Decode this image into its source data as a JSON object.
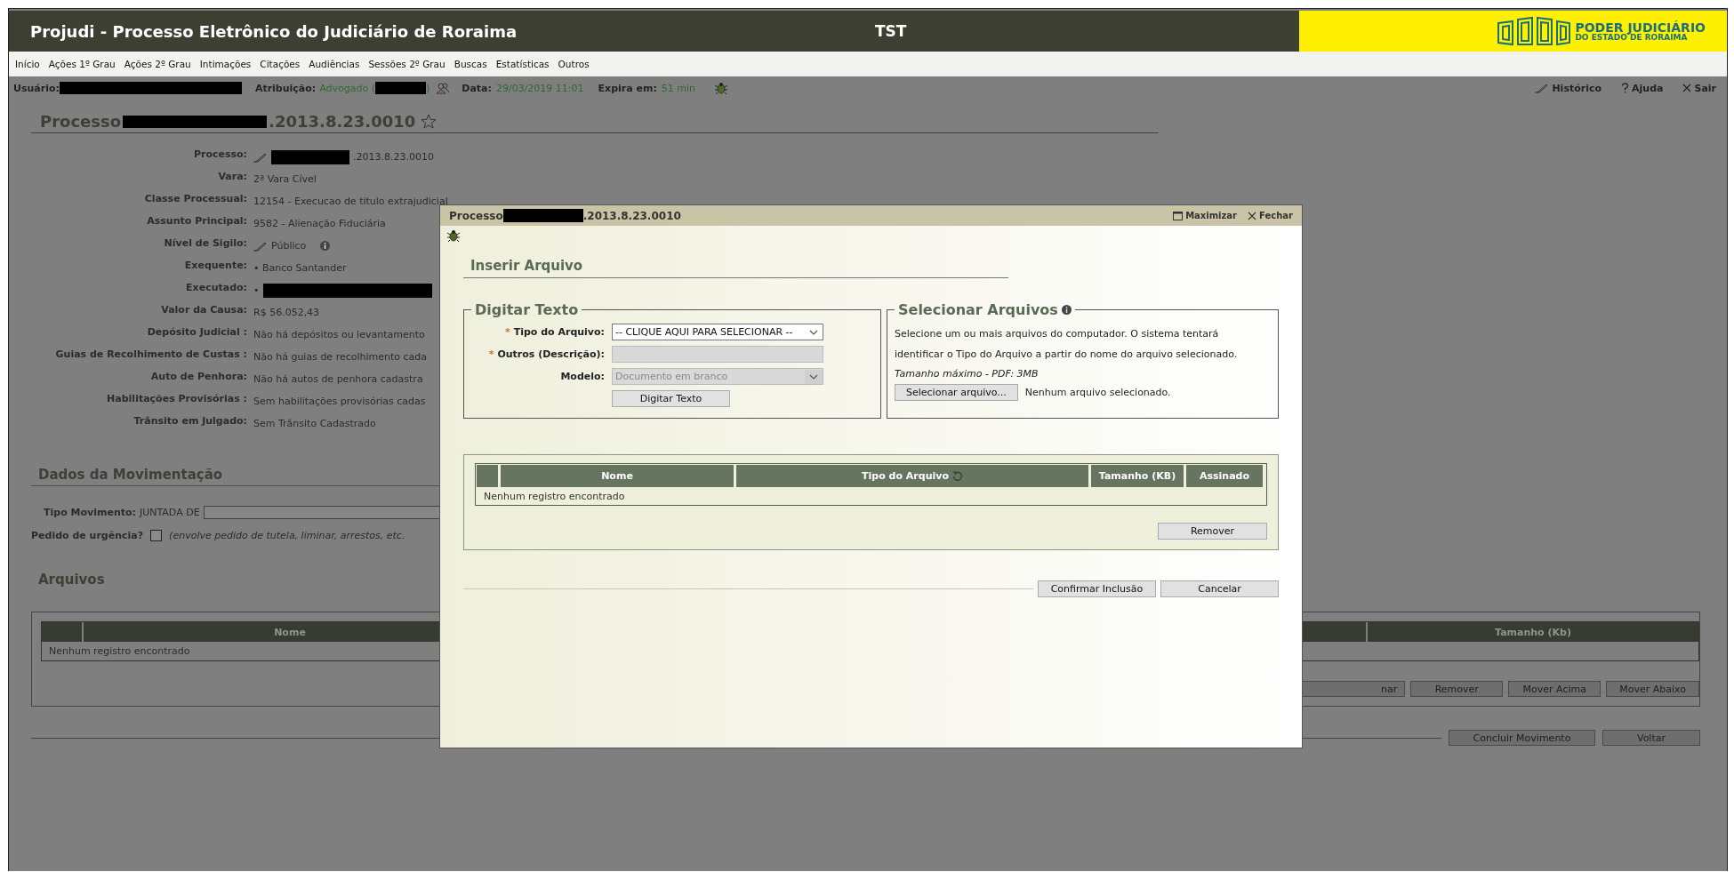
{
  "header": {
    "title": "Projudi - Processo Eletrônico do Judiciário de Roraima",
    "center_label": "TST",
    "logo": {
      "line_1": "PODER JUDICIÁRIO",
      "line_2": "DO ESTADO DE RORAIMA"
    }
  },
  "menu": [
    "Início",
    "Ações 1º Grau",
    "Ações 2º Grau",
    "Intimações",
    "Citações",
    "Audiências",
    "Sessões 2º Grau",
    "Buscas",
    "Estatísticas",
    "Outros"
  ],
  "user_bar": {
    "user_label": "Usuário:",
    "attribution_label": "Atribuição:",
    "attribution_prefix": "Advogado (",
    "attribution_suffix": ")",
    "date_label": "Data:",
    "date_value": "29/03/2019 11:01",
    "expires_label": "Expira em:",
    "expires_value": "51 min",
    "links": [
      {
        "kind": "history",
        "label": "Histórico"
      },
      {
        "kind": "help",
        "label": "Ajuda"
      },
      {
        "kind": "exit",
        "label": "Sair"
      }
    ]
  },
  "process": {
    "title_parts": [
      {
        "kind": "text",
        "text": "Processo"
      },
      {
        "kind": "redacted"
      },
      {
        "kind": "text",
        "text": ".2013.8.23.0010"
      }
    ],
    "favorite": false,
    "details": [
      {
        "label": "Processo:",
        "parts": [
          {
            "kind": "edit"
          },
          {
            "kind": "redacted"
          },
          {
            "kind": "text",
            "text": ".2013.8.23.0010"
          }
        ]
      },
      {
        "label": "Vara:",
        "parts": [
          {
            "kind": "text",
            "text": "2ª Vara Cível"
          }
        ]
      },
      {
        "label": "Classe Processual:",
        "parts": [
          {
            "kind": "text",
            "text": "12154 - Execucao de titulo extrajudicial"
          }
        ]
      },
      {
        "label": "Assunto Principal:",
        "parts": [
          {
            "kind": "text",
            "text": "9582 - Alienação Fiduciária"
          }
        ]
      },
      {
        "label": "Nível de Sigilo:",
        "parts": [
          {
            "kind": "edit"
          },
          {
            "kind": "text",
            "text": "Público"
          },
          {
            "kind": "info"
          }
        ]
      },
      {
        "label": "Exequente:",
        "parts": [
          {
            "kind": "text",
            "text": "• Banco Santander"
          }
        ]
      },
      {
        "label": "Executado:",
        "parts": [
          {
            "kind": "text",
            "text": "•"
          },
          {
            "kind": "redacted-wide"
          }
        ]
      },
      {
        "label": "Valor da Causa:",
        "parts": [
          {
            "kind": "text",
            "text": "R$ 56.052,43"
          }
        ]
      },
      {
        "label": "Depósito Judicial :",
        "parts": [
          {
            "kind": "text",
            "text": "Não há depósitos ou levantamento"
          }
        ]
      },
      {
        "label": "Guias de Recolhimento de Custas :",
        "parts": [
          {
            "kind": "text",
            "text": "Não há guias de recolhimento cada"
          }
        ]
      },
      {
        "label": "Auto de Penhora:",
        "parts": [
          {
            "kind": "text",
            "text": "Não há autos de penhora cadastra"
          }
        ]
      },
      {
        "label": "Habilitações Provisórias :",
        "parts": [
          {
            "kind": "text",
            "text": "Sem habilitações provisórias cadas"
          }
        ]
      },
      {
        "label": "Trânsito em Julgado:",
        "parts": [
          {
            "kind": "text",
            "text": "Sem Trânsito Cadastrado"
          }
        ]
      }
    ]
  },
  "movement": {
    "heading": "Dados da Movimentação",
    "type_label": "Tipo Movimento:",
    "type_value": "JUNTADA DE",
    "urgency_label": "Pedido de urgência?",
    "urgency_checked": false,
    "urgency_note": "(envolve pedido de tutela, liminar, arrestos, etc."
  },
  "files": {
    "heading": "Arquivos",
    "columns": [
      "Nome",
      "Tamanho (Kb)"
    ],
    "empty_message": "Nenhum registro encontrado",
    "buttons": [
      "nar",
      "Remover",
      "Mover Acima",
      "Mover Abaixo"
    ]
  },
  "footer_buttons": [
    "Concluir Movimento",
    "Voltar"
  ],
  "modal": {
    "title_parts": [
      {
        "kind": "text",
        "text": "Processo"
      },
      {
        "kind": "redacted"
      },
      {
        "kind": "text",
        "text": ".2013.8.23.0010"
      }
    ],
    "actions": [
      {
        "kind": "maximize",
        "label": "Maximizar"
      },
      {
        "kind": "close",
        "label": "Fechar"
      }
    ],
    "heading": "Inserir Arquivo",
    "text_panel": {
      "legend": "Digitar Texto",
      "fields": [
        {
          "kind": "select",
          "label": "Tipo do Arquivo:",
          "required_mark": "*",
          "disabled": false,
          "value": "-- CLIQUE AQUI PARA SELECIONAR --"
        },
        {
          "kind": "text",
          "label": "Outros (Descrição):",
          "required_mark": "*",
          "disabled": true
        },
        {
          "kind": "select",
          "label": "Modelo:",
          "disabled": true,
          "value": "Documento em branco"
        }
      ],
      "button": "Digitar Texto"
    },
    "file_panel": {
      "legend": "Selecionar Arquivos",
      "description": "Selecione um ou mais arquivos do computador. O sistema tentará identificar o Tipo do Arquivo a partir do nome do arquivo selecionado.",
      "max_size": "Tamanho máximo - PDF: 3MB",
      "button": "Selecionar arquivo...",
      "status": "Nenhum arquivo selecionado."
    },
    "table": {
      "columns": [
        {
          "kind": "plain",
          "label": "Nome"
        },
        {
          "kind": "refresh",
          "label": "Tipo do Arquivo"
        },
        {
          "kind": "plain",
          "label": "Tamanho (KB)"
        },
        {
          "kind": "plain",
          "label": "Assinado"
        }
      ],
      "empty_message": "Nenhum registro encontrado",
      "button": "Remover"
    },
    "buttons": [
      "Confirmar Inclusão",
      "Cancelar"
    ]
  }
}
